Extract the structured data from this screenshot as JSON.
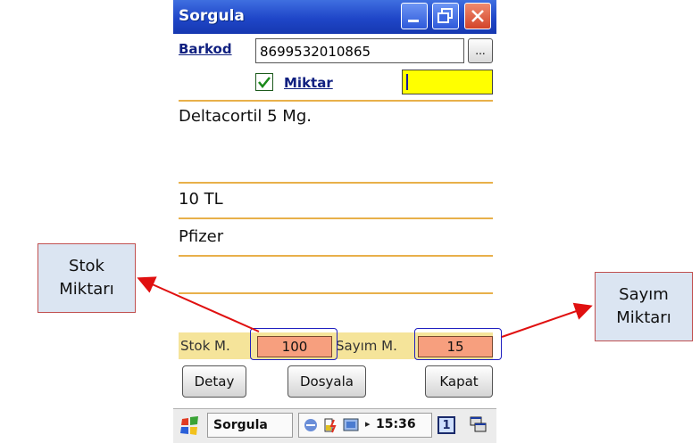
{
  "window": {
    "title": "Sorgula",
    "title_buttons": [
      "minimize-icon",
      "maximize-icon",
      "close-icon"
    ]
  },
  "form": {
    "barkod_label": "Barkod",
    "barkod_value": "8699532010865",
    "browse_label": "...",
    "miktar_checked": true,
    "miktar_label": "Miktar",
    "miktar_value": ""
  },
  "product": {
    "name": "Deltacortil 5 Mg.",
    "price": "10 TL",
    "manufacturer": "Pfizer"
  },
  "summary": {
    "stok_label": "Stok M.",
    "stok_value": "100",
    "sayim_label": "Sayım M.",
    "sayim_value": "15"
  },
  "buttons": {
    "detay": "Detay",
    "dosyala": "Dosyala",
    "kapat": "Kapat"
  },
  "taskbar": {
    "app_label": "Sorgula",
    "time": "15:36",
    "desktop_number": "1"
  },
  "callouts": {
    "stok_line1": "Stok",
    "stok_line2": "Miktarı",
    "sayim_line1": "Sayım",
    "sayim_line2": "Miktarı"
  },
  "colors": {
    "title_bar": "#1f46c8",
    "input_highlight": "#ffff00",
    "value_box": "#f79f7e",
    "divider": "#e8b04a",
    "callout_bg": "#dbe5f2",
    "arrow": "#e01010"
  }
}
